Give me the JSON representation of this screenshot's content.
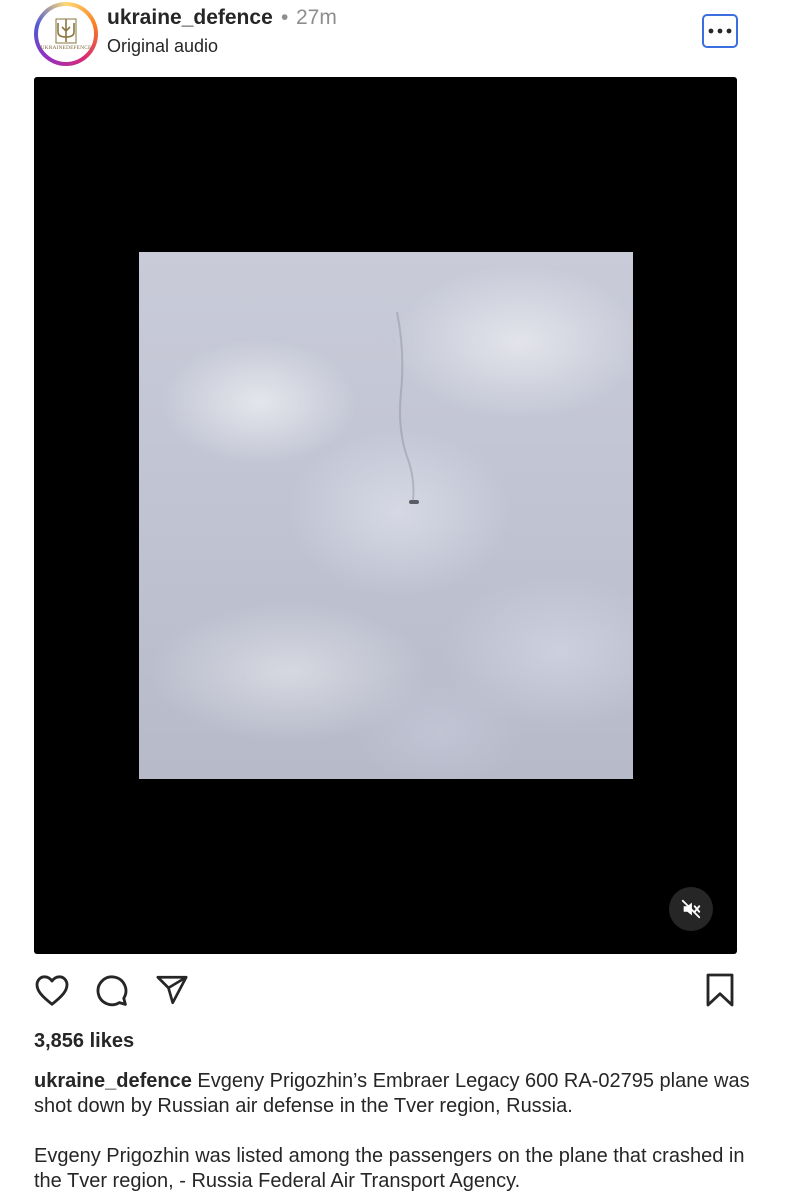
{
  "post": {
    "username": "ukraine_defence",
    "separator": "•",
    "time_ago": "27m",
    "audio_label": "Original audio",
    "avatar_text": "UKRAINEDEFENCE",
    "likes": "3,856 likes",
    "caption_username": "ukraine_defence",
    "caption_line1": " Evgeny Prigozhin’s Embraer Legacy 600 RA-02795 plane was shot down by Russian air defense in the Tver region, Russia.",
    "caption_para2": "Evgeny Prigozhin was listed among the passengers on the plane that crashed in the Tver region, - Russia Federal Air Transport Agency."
  },
  "icons": {
    "more": "more-horizontal-icon",
    "mute": "muted-speaker-icon",
    "like": "heart-icon",
    "comment": "comment-bubble-icon",
    "share": "paper-plane-icon",
    "save": "bookmark-icon"
  },
  "colors": {
    "text": "#262626",
    "muted": "#8e8e8e",
    "focus": "#3b6fe0"
  }
}
